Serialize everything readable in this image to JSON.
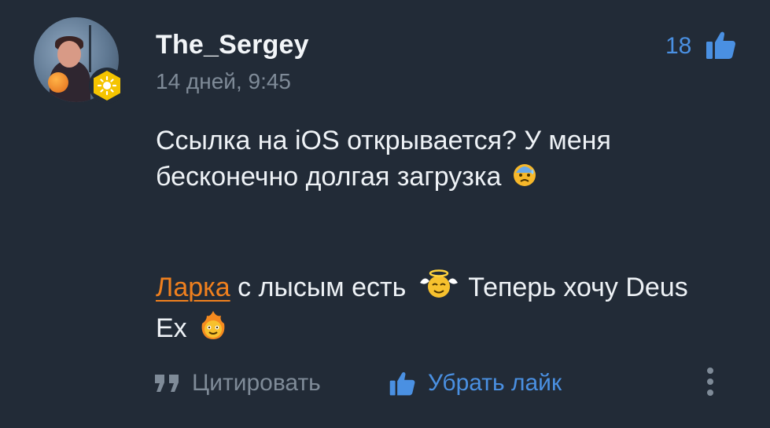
{
  "comment": {
    "author": "The_Sergey",
    "timestamp": "14 дней, 9:45",
    "like_count": "18",
    "message": {
      "line1_text": "Ссылка на iOS открывается? У меня бесконечно долгая загрузка",
      "line1_emoji": "anxious-face-emoji",
      "mention": "Ларка",
      "line2_text_a": "с лысым есть",
      "line2_emoji_a": "angel-face-emoji",
      "line2_text_b": "Теперь хочу Deus Ex",
      "line2_emoji_b": "fire-face-emoji"
    }
  },
  "actions": {
    "quote_label": "Цитировать",
    "unlike_label": "Убрать лайк"
  },
  "icons": {
    "like": "thumbs-up-icon",
    "quote": "quote-icon",
    "more": "more-vertical-icon",
    "badge": "sun-badge-icon"
  },
  "colors": {
    "background": "#222b37",
    "accent_blue": "#4a90e2",
    "mention_orange": "#f0801e",
    "muted_text": "#7f8b98",
    "badge_yellow": "#f5c400"
  }
}
